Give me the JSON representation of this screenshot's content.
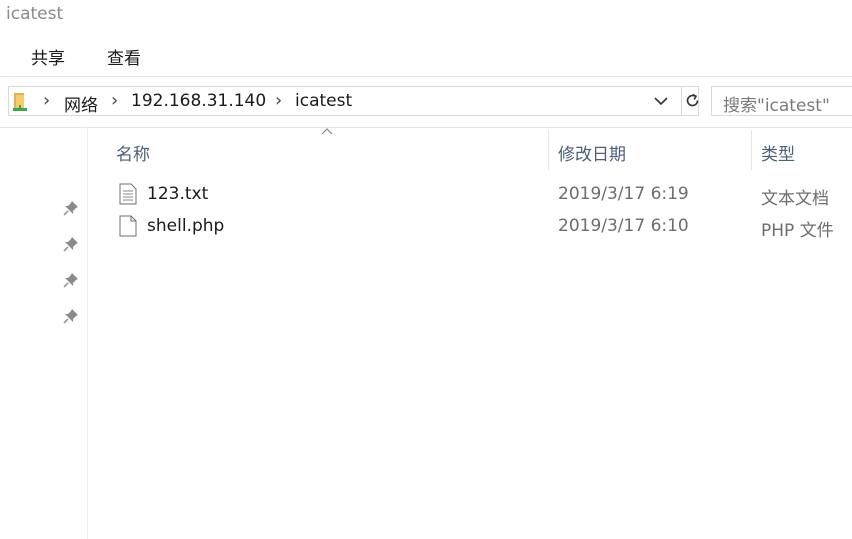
{
  "window": {
    "title": "icatest"
  },
  "ribbon": {
    "tabs": [
      "共享",
      "查看"
    ]
  },
  "address_bar": {
    "icon": "folder-network-icon",
    "crumbs": [
      "网络",
      "192.168.31.140",
      "icatest"
    ]
  },
  "search": {
    "placeholder": "搜索\"icatest\""
  },
  "columns": {
    "name": "名称",
    "date": "修改日期",
    "type": "类型"
  },
  "files": [
    {
      "name": "123.txt",
      "date": "2019/3/17 6:19",
      "type": "文本文档",
      "icon": "text-file-icon"
    },
    {
      "name": "shell.php",
      "date": "2019/3/17 6:10",
      "type": "PHP 文件",
      "icon": "blank-file-icon"
    }
  ],
  "quick_access": {
    "pins": 4,
    "icon": "pin-icon"
  },
  "colors": {
    "header_text": "#4c607a",
    "folder_yellow": "#e8b04a",
    "folder_green": "#3fa34d"
  }
}
